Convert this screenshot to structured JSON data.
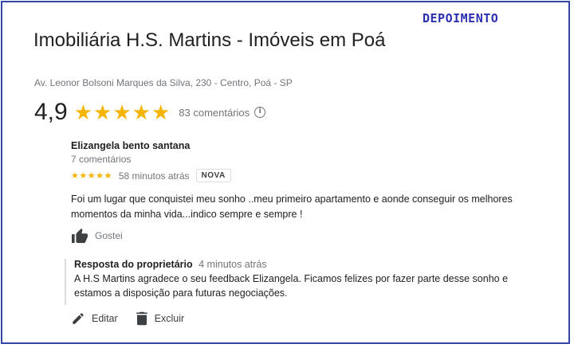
{
  "header": {
    "tag": "DEPOIMENTO",
    "title": "Imobiliária H.S. Martins - Imóveis em Poá",
    "address": "Av. Leonor Bolsoni Marques da Silva, 230 - Centro, Poá - SP"
  },
  "rating": {
    "value": "4,9",
    "stars": "★★★★★",
    "count_label": "83 comentários",
    "info_icon": "info-icon"
  },
  "review": {
    "author": "Elizangela bento santana",
    "author_sub": "7 comentários",
    "stars": "★★★★★",
    "time": "58 minutos atrás",
    "badge": "NOVA",
    "text": "Foi um lugar que conquistei meu sonho ..meu primeiro apartamento e aonde conseguir os melhores momentos da minha vida...indico sempre e sempre !",
    "like_label": "Gostei",
    "like_icon": "thumbs-up-icon"
  },
  "owner_reply": {
    "label": "Resposta do proprietário",
    "time": "4 minutos atrás",
    "text": "A H.S Martins agradece o seu feedback Elizangela. Ficamos felizes por fazer parte desse sonho e estamos a disposição para futuras negociações."
  },
  "actions": {
    "edit_label": "Editar",
    "edit_icon": "pencil-icon",
    "delete_label": "Excluir",
    "delete_icon": "trash-icon"
  },
  "colors": {
    "star": "#f4b400",
    "frame": "#3346a8",
    "tag": "#2b2fb0"
  }
}
